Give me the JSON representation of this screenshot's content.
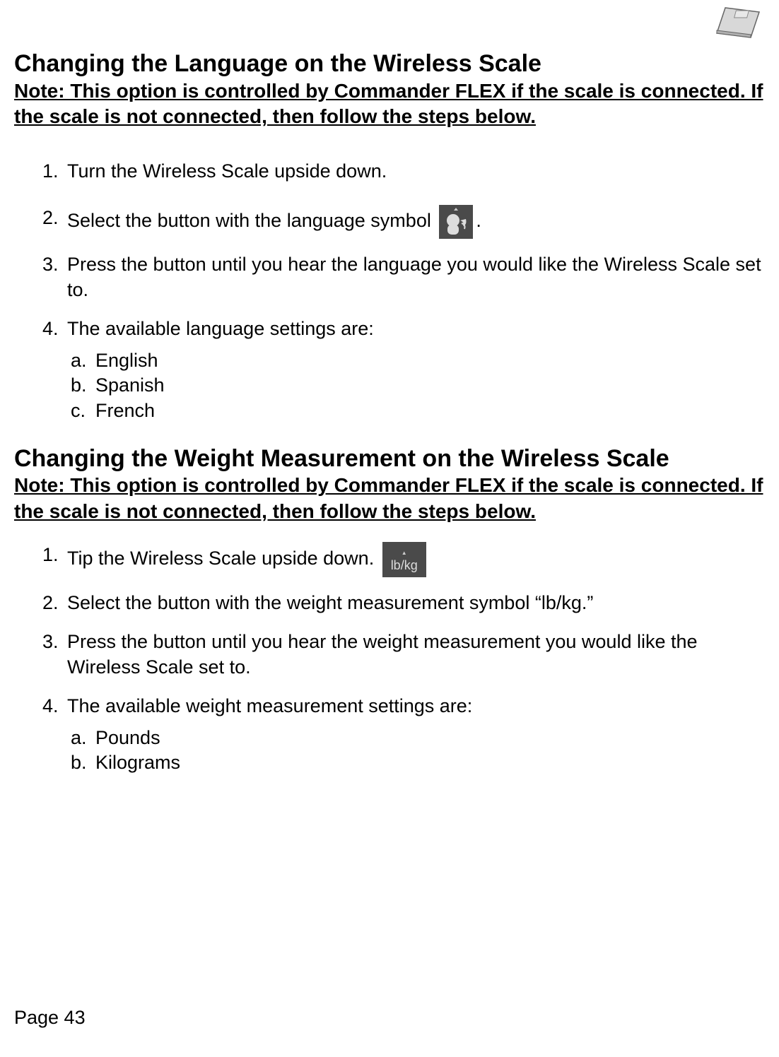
{
  "header_icon": "scale-icon",
  "section1": {
    "title": "Changing the Language on the Wireless Scale",
    "note": "Note: This option is controlled by Commander FLEX if the scale is connected.  If the scale is not connected, then follow the steps below.",
    "steps": {
      "s1": "Turn the Wireless Scale upside down.",
      "s2a": "Select the button with the language symbol ",
      "s2b": ".",
      "s3": "Press the button until you hear the language you would like the Wireless Scale set to.",
      "s4": "The available language settings are:",
      "sub": {
        "a": "English",
        "b": "Spanish",
        "c": "French"
      }
    }
  },
  "section2": {
    "title": "Changing the Weight Measurement on the Wireless Scale",
    "note": "Note: This option is controlled by Commander FLEX if the scale is connected.  If the scale is not connected, then follow the steps below.",
    "steps": {
      "s1": "Tip the Wireless Scale upside down. ",
      "s2": "Select the button with the weight measurement symbol  “lb/kg.”",
      "s3": "Press the button until you hear the weight measurement you would like the Wireless Scale set to.",
      "s4": "The available weight measurement settings are:",
      "sub": {
        "a": "Pounds",
        "b": "Kilograms"
      }
    }
  },
  "icons": {
    "lbkg_label": "lb/kg"
  },
  "footer": {
    "page": "Page 43"
  }
}
